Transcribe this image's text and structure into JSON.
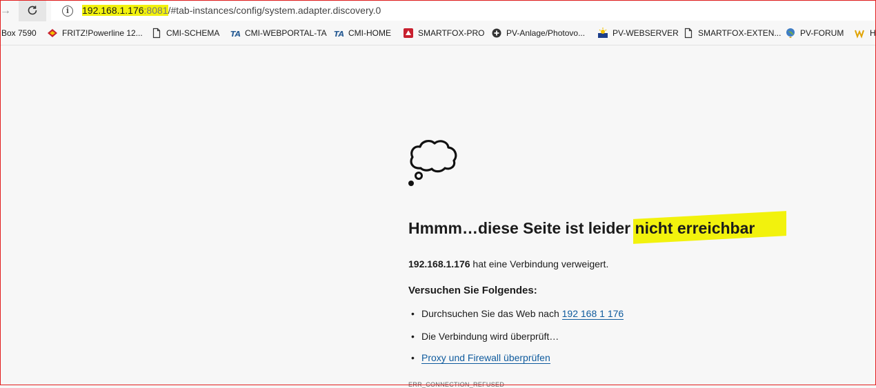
{
  "toolbar": {
    "url_host": "192.168.1.176",
    "url_port": ":8081",
    "url_path": "/#tab-instances/config/system.adapter.discovery.0",
    "info_symbol": "i"
  },
  "bookmarks": [
    {
      "label": "Box 7590",
      "icon": "none"
    },
    {
      "label": "FRITZ!Powerline 12...",
      "icon": "fritz-icon"
    },
    {
      "label": "CMI-SCHEMA",
      "icon": "page-icon"
    },
    {
      "label": "CMI-WEBPORTAL-TA",
      "icon": "ta-icon"
    },
    {
      "label": "CMI-HOME",
      "icon": "ta-icon"
    },
    {
      "label": "SMARTFOX-PRO",
      "icon": "smartfox-icon"
    },
    {
      "label": "PV-Anlage/Photovo...",
      "icon": "plus-circle-icon"
    },
    {
      "label": "PV-WEBSERVER",
      "icon": "sun-flag-icon"
    },
    {
      "label": "SMARTFOX-EXTEN...",
      "icon": "page-icon"
    },
    {
      "label": "PV-FORUM",
      "icon": "globe-pin-icon"
    },
    {
      "label": "H",
      "icon": "h-icon"
    }
  ],
  "error": {
    "title": "Hmmm…diese Seite ist leider nicht erreichbar",
    "host": "192.168.1.176",
    "refused_text": " hat eine Verbindung verweigert.",
    "try_heading": "Versuchen Sie Folgendes:",
    "bullet": "•",
    "item1_prefix": "Durchsuchen Sie das Web nach ",
    "item1_link": "192 168 1 176",
    "item2": "Die Verbindung wird überprüft…",
    "item3_link": "Proxy und Firewall überprüfen",
    "error_code": "ERR_CONNECTION_REFUSED"
  },
  "colors": {
    "highlight": "#f2f20d",
    "link": "#0e5a9d",
    "frame": "#e21d1d"
  }
}
